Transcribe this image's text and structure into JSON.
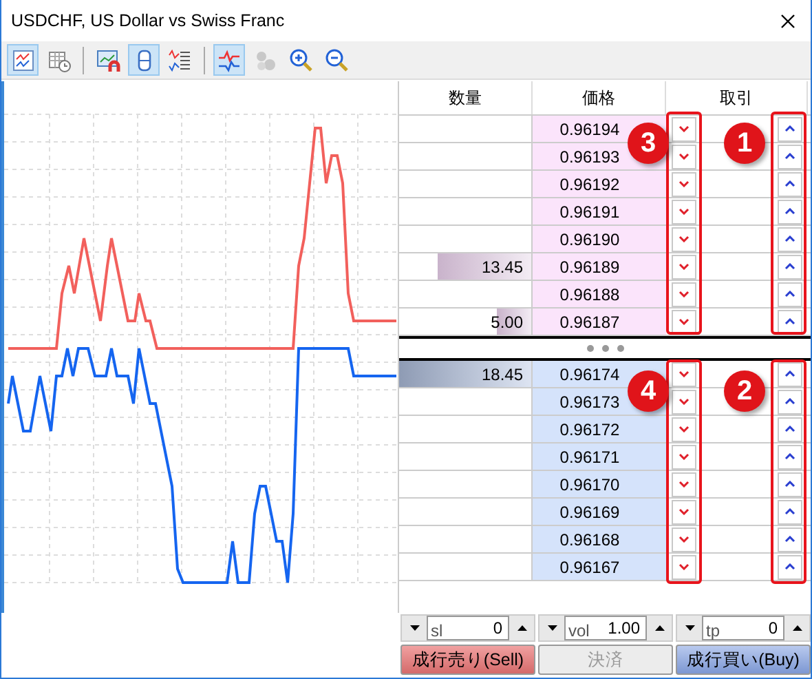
{
  "window": {
    "title": "USDCHF, US Dollar vs Swiss Franc"
  },
  "toolbar": [
    {
      "selected": true,
      "disabled": false
    },
    {
      "selected": false,
      "disabled": false
    },
    {
      "selected": false,
      "disabled": false
    },
    {
      "selected": true,
      "disabled": false
    },
    {
      "selected": false,
      "disabled": false
    },
    {
      "selected": true,
      "disabled": false
    },
    {
      "selected": false,
      "disabled": true
    },
    {
      "selected": false,
      "disabled": false
    },
    {
      "selected": false,
      "disabled": false
    }
  ],
  "depth": {
    "columns": [
      "数量",
      "価格",
      "取引"
    ],
    "ask_rows": [
      {
        "price": "0.96194"
      },
      {
        "price": "0.96193"
      },
      {
        "price": "0.96192"
      },
      {
        "price": "0.96191"
      },
      {
        "price": "0.96190"
      },
      {
        "volume": "13.45",
        "level": 0.71,
        "price": "0.96189"
      },
      {
        "price": "0.96188"
      },
      {
        "volume": "5.00",
        "level": 0.26,
        "price": "0.96187"
      }
    ],
    "bid_rows": [
      {
        "volume": "18.45",
        "level": 1,
        "price": "0.96174"
      },
      {
        "price": "0.96173"
      },
      {
        "price": "0.96172"
      },
      {
        "price": "0.96171"
      },
      {
        "price": "0.96170"
      },
      {
        "price": "0.96169"
      },
      {
        "price": "0.96168"
      },
      {
        "price": "0.96167"
      }
    ]
  },
  "callouts": [
    {
      "label": "3"
    },
    {
      "label": "1"
    },
    {
      "label": "4"
    },
    {
      "label": "2"
    }
  ],
  "fields": [
    {
      "placeholder": "sl",
      "value": "0"
    },
    {
      "placeholder": "vol",
      "value": "1.00"
    },
    {
      "placeholder": "tp",
      "value": "0"
    }
  ],
  "buttons": [
    {
      "kind": "sell",
      "label": "成行売り(Sell)",
      "disabled": false
    },
    {
      "kind": "close",
      "label": "決済",
      "disabled": true
    },
    {
      "kind": "buy",
      "label": "成行買い(Buy)",
      "disabled": false
    }
  ]
}
